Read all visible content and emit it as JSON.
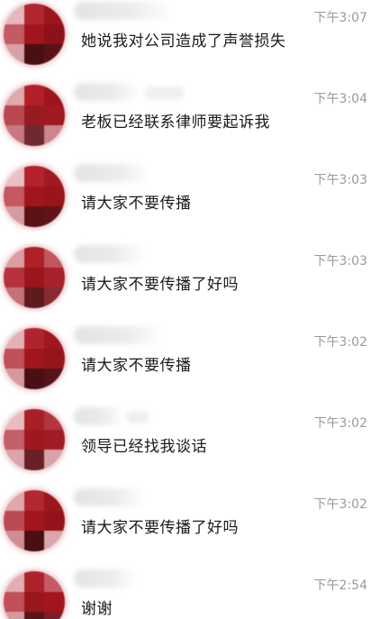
{
  "chats": [
    {
      "message": "她说我对公司造成了声誉损失",
      "time": "下午3:07"
    },
    {
      "message": "老板已经联系律师要起诉我",
      "time": "下午3:04"
    },
    {
      "message": "请大家不要传播",
      "time": "下午3:03"
    },
    {
      "message": "请大家不要传播了好吗",
      "time": "下午3:03"
    },
    {
      "message": "请大家不要传播",
      "time": "下午3:02"
    },
    {
      "message": "领导已经找我谈话",
      "time": "下午3:02"
    },
    {
      "message": "请大家不要传播了好吗",
      "time": "下午3:02"
    },
    {
      "message": "谢谢",
      "time": "下午2:54"
    }
  ],
  "colors": {
    "avatar_primary": "#a3151d",
    "avatar_dark": "#4a0f12",
    "avatar_light": "#d6939a",
    "time_text": "#9a9a9a",
    "message_text": "#1a1a1a"
  }
}
